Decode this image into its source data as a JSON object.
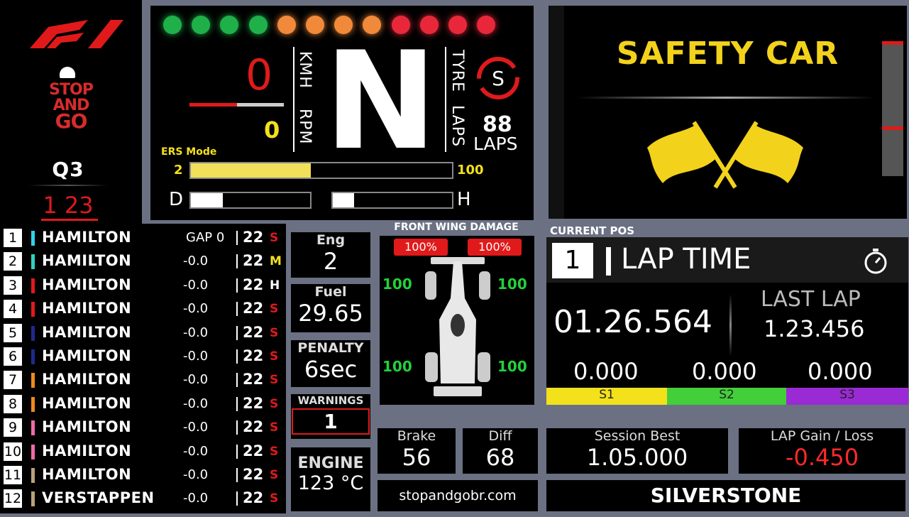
{
  "left": {
    "logo_text": "F1",
    "brand": {
      "line1": "STOP",
      "line2": "AND",
      "line3": "GO"
    },
    "session": "Q3",
    "position": "1 23"
  },
  "standings": [
    {
      "pos": "1",
      "name": "HAMILTON",
      "gap": "GAP 0",
      "lap": "22",
      "tyre": "S",
      "color": "#2fd3e8",
      "tyre_color": "#e01a1a"
    },
    {
      "pos": "2",
      "name": "HAMILTON",
      "gap": "-0.0",
      "lap": "22",
      "tyre": "M",
      "color": "#2fd3c0",
      "tyre_color": "#f3e11b"
    },
    {
      "pos": "3",
      "name": "HAMILTON",
      "gap": "-0.0",
      "lap": "22",
      "tyre": "H",
      "color": "#e01a1a",
      "tyre_color": "#ffffff"
    },
    {
      "pos": "4",
      "name": "HAMILTON",
      "gap": "-0.0",
      "lap": "22",
      "tyre": "S",
      "color": "#e01a1a",
      "tyre_color": "#e01a1a"
    },
    {
      "pos": "5",
      "name": "HAMILTON",
      "gap": "-0.0",
      "lap": "22",
      "tyre": "S",
      "color": "#1e2a8c",
      "tyre_color": "#e01a1a"
    },
    {
      "pos": "6",
      "name": "HAMILTON",
      "gap": "-0.0",
      "lap": "22",
      "tyre": "S",
      "color": "#1e2a8c",
      "tyre_color": "#e01a1a"
    },
    {
      "pos": "7",
      "name": "HAMILTON",
      "gap": "-0.0",
      "lap": "22",
      "tyre": "S",
      "color": "#f08a1b",
      "tyre_color": "#e01a1a"
    },
    {
      "pos": "8",
      "name": "HAMILTON",
      "gap": "-0.0",
      "lap": "22",
      "tyre": "S",
      "color": "#f08a1b",
      "tyre_color": "#e01a1a"
    },
    {
      "pos": "9",
      "name": "HAMILTON",
      "gap": "-0.0",
      "lap": "22",
      "tyre": "S",
      "color": "#f06aa8",
      "tyre_color": "#e01a1a"
    },
    {
      "pos": "10",
      "name": "HAMILTON",
      "gap": "-0.0",
      "lap": "22",
      "tyre": "S",
      "color": "#f06aa8",
      "tyre_color": "#e01a1a"
    },
    {
      "pos": "11",
      "name": "HAMILTON",
      "gap": "-0.0",
      "lap": "22",
      "tyre": "S",
      "color": "#b8a27a",
      "tyre_color": "#e01a1a"
    },
    {
      "pos": "12",
      "name": "VERSTAPPEN",
      "gap": "-0.0",
      "lap": "22",
      "tyre": "S",
      "color": "#b8a27a",
      "tyre_color": "#e01a1a"
    }
  ],
  "dash": {
    "leds": [
      "#1fb04a",
      "#1fb04a",
      "#1fb04a",
      "#1fb04a",
      "#f08a3a",
      "#f08a3a",
      "#f08a3a",
      "#f08a3a",
      "#e8283a",
      "#e8283a",
      "#e8283a",
      "#e8283a"
    ],
    "kmh_value": "0",
    "kmh_label": "KMH",
    "rpm_value": "0",
    "rpm_label": "RPM",
    "gear": "N",
    "tyre_label": "TYRE",
    "laps_label": "LAPS",
    "tyre_compound": "S",
    "laps_value": "88",
    "laps_unit": "LAPS",
    "ers_label": "ERS Mode",
    "ers_min": "2",
    "ers_max": "100",
    "ers_level": 0.46,
    "d_label": "D",
    "h_label": "H",
    "d_level": 0.27,
    "h_level": 0.18,
    "rpm_level": 0.5
  },
  "safety": {
    "title": "SAFETY CAR"
  },
  "tiles": {
    "eng_label": "Eng",
    "eng_value": "2",
    "fuel_label": "Fuel",
    "fuel_value": "29.65",
    "penalty_label": "PENALTY",
    "penalty_value": "6sec",
    "warnings_label": "WARNINGS",
    "warnings_value": "1",
    "engine_label": "ENGINE",
    "engine_value": "123 °C",
    "brake_label": "Brake",
    "brake_value": "56",
    "diff_label": "Diff",
    "diff_value": "68",
    "session_best_label": "Session Best",
    "session_best_value": "1.05.000",
    "gain_label": "LAP Gain / Loss",
    "gain_value": "-0.450",
    "site": "stopandgobr.com",
    "track": "SILVERSTONE"
  },
  "wing": {
    "title": "FRONT WING DAMAGE",
    "left_pct": "100%",
    "right_pct": "100%",
    "fl": "100",
    "fr": "100",
    "rl": "100",
    "rr": "100"
  },
  "lap": {
    "current_pos_label": "CURRENT POS",
    "pos": "1",
    "title": "LAP TIME",
    "time": "01.26.564",
    "last_lap_label": "LAST LAP",
    "last_lap": "1.23.456",
    "s1": "0.000",
    "s2": "0.000",
    "s3": "0.000",
    "s1_label": "S1",
    "s2_label": "S2",
    "s3_label": "S3"
  }
}
